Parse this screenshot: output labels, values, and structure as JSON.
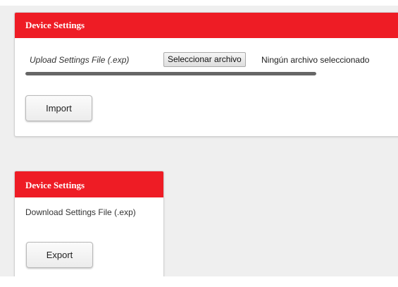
{
  "import_panel": {
    "title": "Device Settings",
    "upload_label": "Upload Settings File (.exp)",
    "file_button_label": "Seleccionar archivo",
    "file_status": "Ningún archivo seleccionado",
    "progress": 1.0,
    "import_label": "Import"
  },
  "export_panel": {
    "title": "Device Settings",
    "download_label": "Download Settings File (.exp)",
    "export_label": "Export"
  },
  "colors": {
    "header_red": "#ee1c25",
    "progress_fill": "#666666"
  }
}
